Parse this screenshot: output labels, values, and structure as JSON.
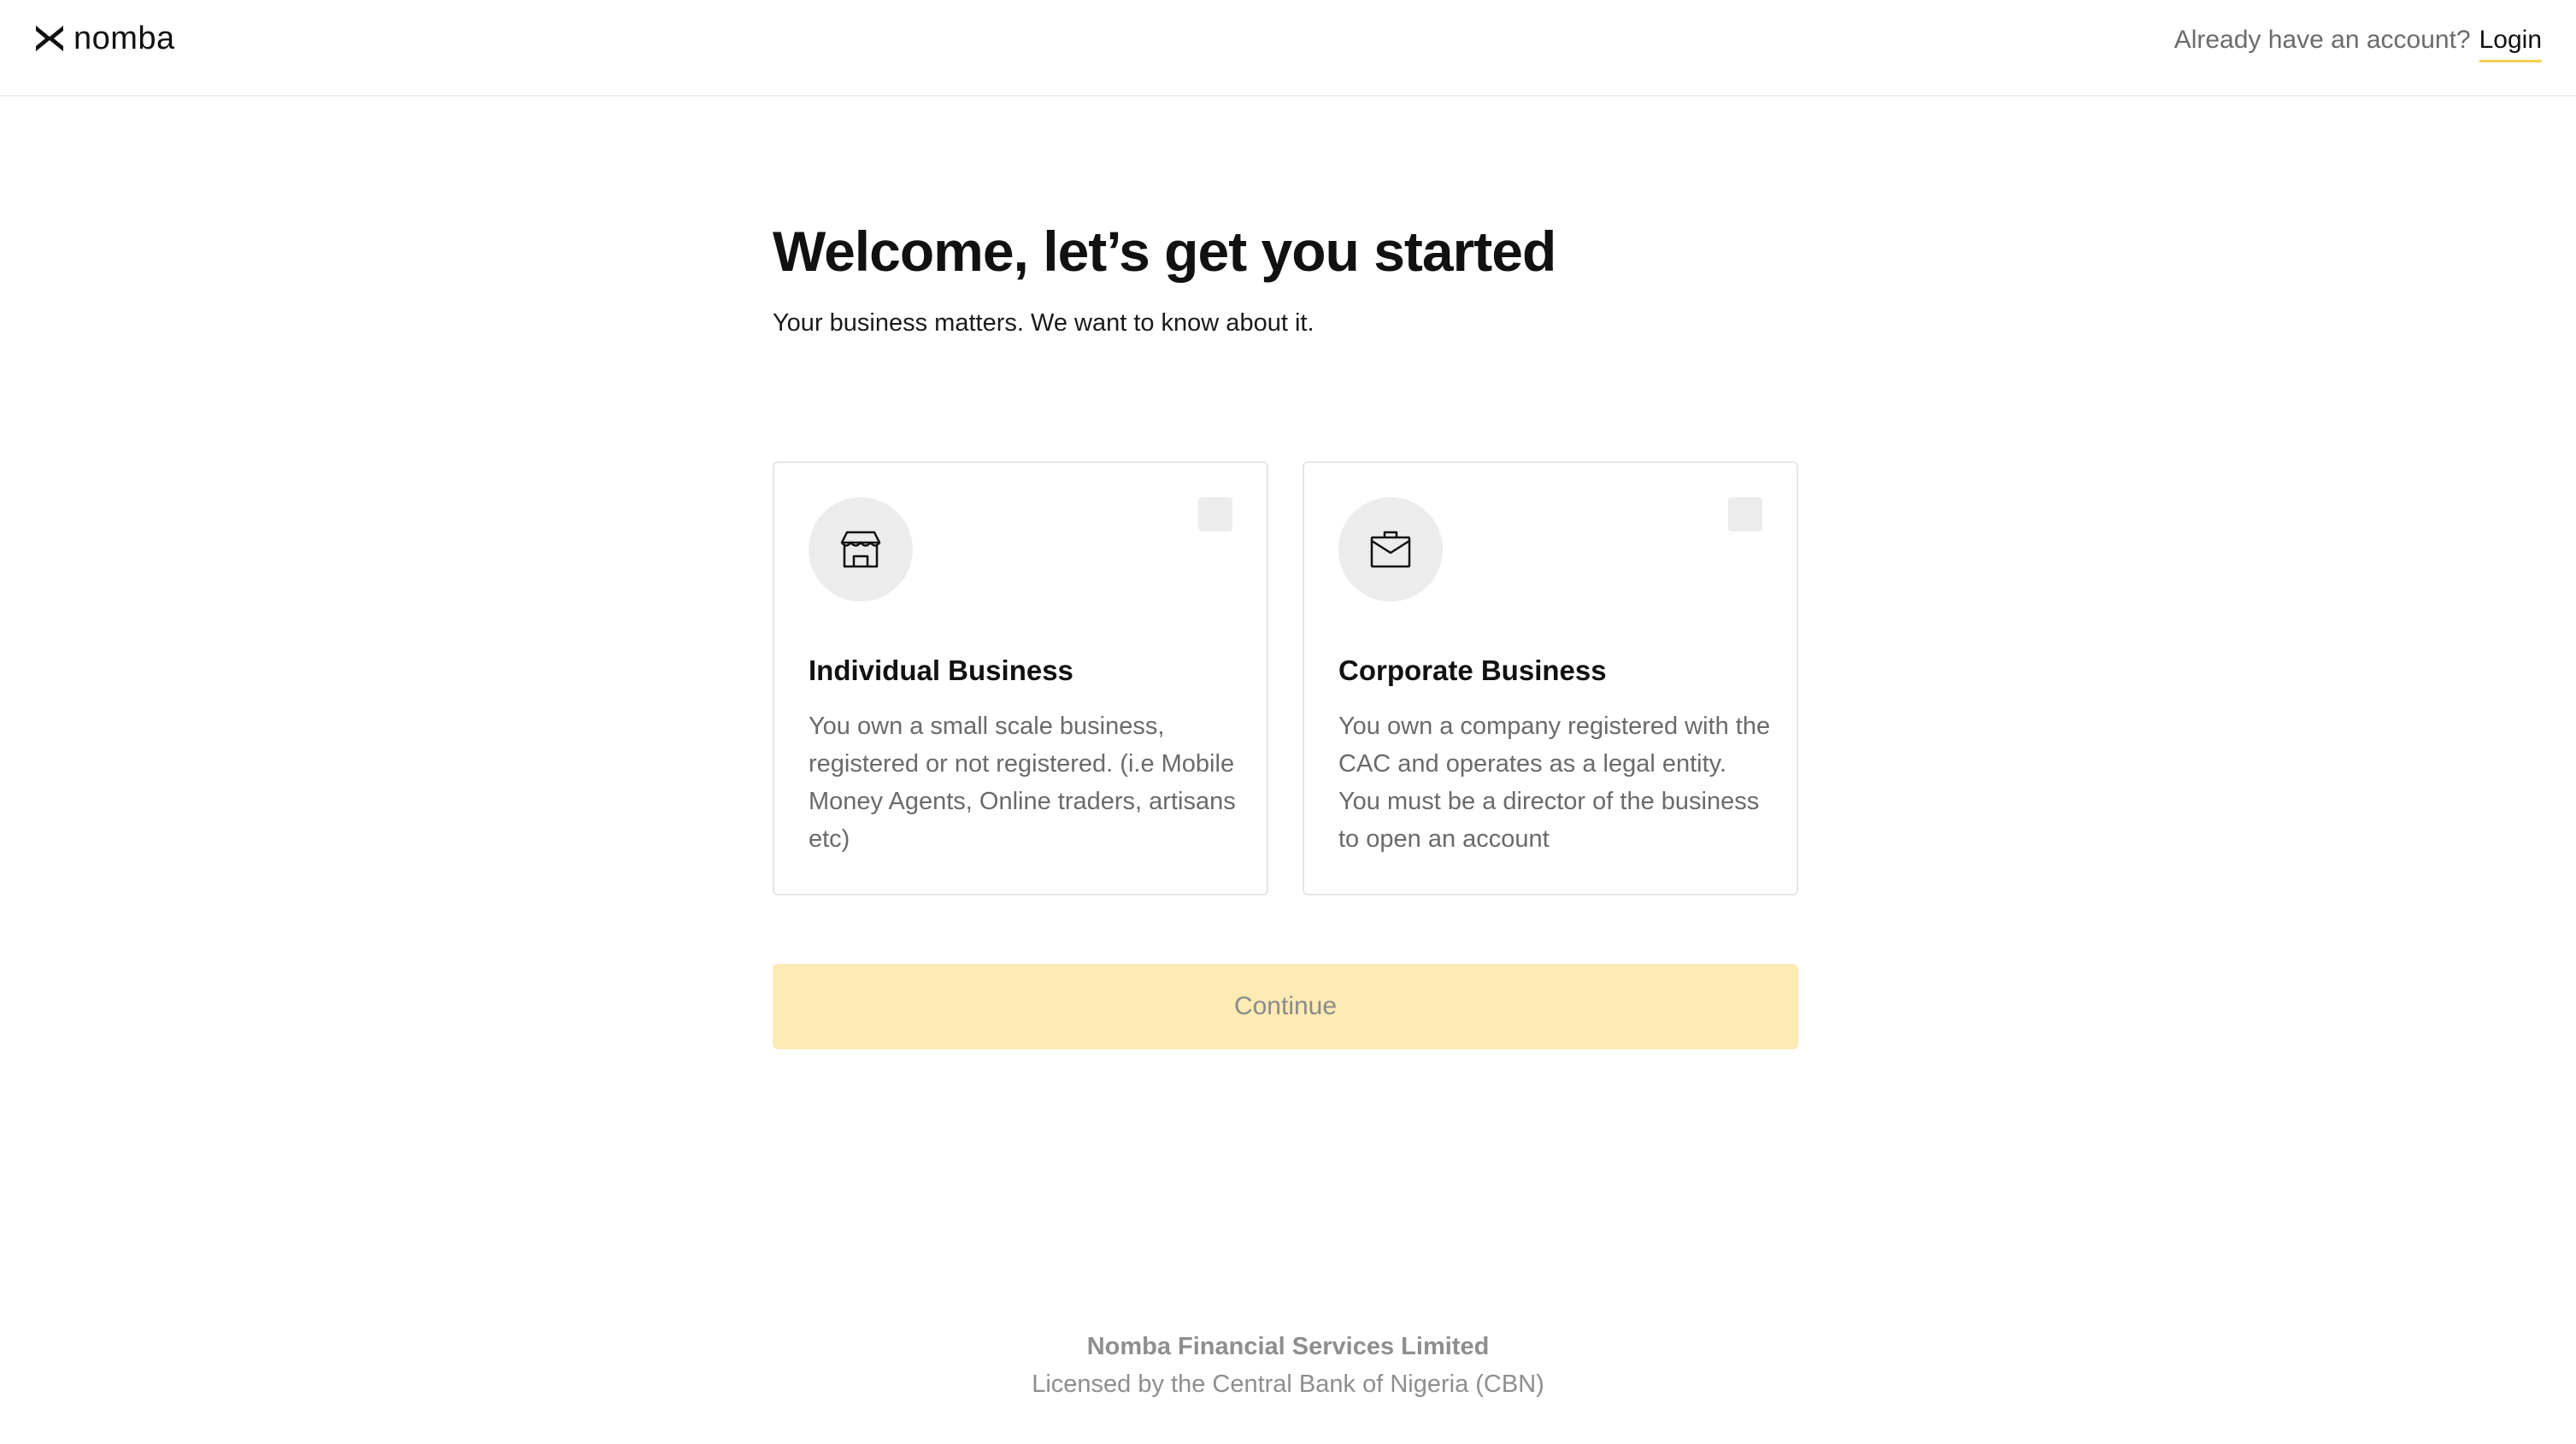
{
  "header": {
    "brand": "nomba",
    "account_prompt": "Already have an account?",
    "login_label": "Login",
    "accent_color": "#f3cf52"
  },
  "main": {
    "title": "Welcome, let’s get you started",
    "subtitle": "Your business matters. We want to know about it.",
    "cards": [
      {
        "icon": "store-icon",
        "title": "Individual Business",
        "description": "You own a small scale business, registered or not registered. (i.e Mobile Money Agents, Online traders, artisans etc)",
        "selected": false
      },
      {
        "icon": "briefcase-icon",
        "title": "Corporate Business",
        "description": "You own a company registered with the CAC and operates as a legal entity. You must be a director of the business to open an account",
        "selected": false
      }
    ],
    "continue_label": "Continue",
    "continue_color": "#fdeab4"
  },
  "footer": {
    "company": "Nomba Financial Services Limited",
    "license": "Licensed by the Central Bank of Nigeria (CBN)"
  }
}
